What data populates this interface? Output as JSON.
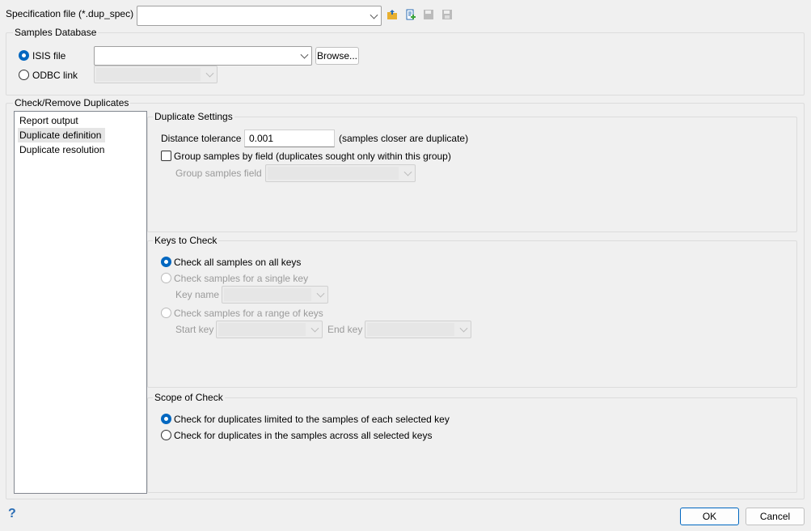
{
  "spec": {
    "label": "Specification file (*.dup_spec)",
    "value": ""
  },
  "toolbar": {
    "icons": [
      "open-folder-icon",
      "new-file-icon",
      "save-icon",
      "save-as-icon"
    ]
  },
  "samples_db": {
    "title": "Samples Database",
    "isis_label": "ISIS file",
    "isis_value": "",
    "browse": "Browse...",
    "odbc_label": "ODBC link",
    "selected": "ISIS file"
  },
  "check": {
    "title": "Check/Remove Duplicates",
    "nav": [
      {
        "label": "Report output"
      },
      {
        "label": "Duplicate definition",
        "selected": true
      },
      {
        "label": "Duplicate resolution"
      }
    ],
    "settings": {
      "title": "Duplicate Settings",
      "tol_label": "Distance tolerance",
      "tol_value": "0.001",
      "tol_note": "(samples closer are duplicate)",
      "group_label": "Group samples by field (duplicates sought only within this group)",
      "group_checked": false,
      "group_field_label": "Group samples field"
    },
    "keys": {
      "title": "Keys to Check",
      "opt_all": "Check all samples on all keys",
      "opt_single": "Check samples for a single key",
      "key_name": "Key name",
      "opt_range": "Check samples for a range of keys",
      "start_key": "Start key",
      "end_key": "End key"
    },
    "scope": {
      "title": "Scope of Check",
      "opt_each": "Check for duplicates limited to the samples of each selected key",
      "opt_across": "Check for duplicates in the samples across all selected keys"
    }
  },
  "footer": {
    "help": "?",
    "ok": "OK",
    "cancel": "Cancel"
  },
  "colors": {
    "accent": "#0067c0",
    "selection": "#e5e5e5"
  }
}
